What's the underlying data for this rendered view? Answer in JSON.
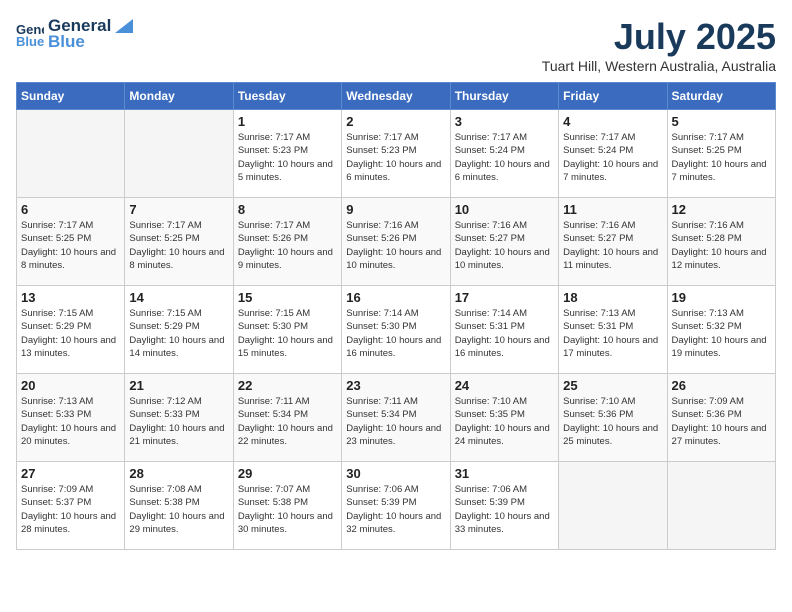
{
  "header": {
    "logo_line1": "General",
    "logo_line2": "Blue",
    "month": "July 2025",
    "location": "Tuart Hill, Western Australia, Australia"
  },
  "weekdays": [
    "Sunday",
    "Monday",
    "Tuesday",
    "Wednesday",
    "Thursday",
    "Friday",
    "Saturday"
  ],
  "weeks": [
    [
      {
        "day": "",
        "sunrise": "",
        "sunset": "",
        "daylight": ""
      },
      {
        "day": "",
        "sunrise": "",
        "sunset": "",
        "daylight": ""
      },
      {
        "day": "1",
        "sunrise": "Sunrise: 7:17 AM",
        "sunset": "Sunset: 5:23 PM",
        "daylight": "Daylight: 10 hours and 5 minutes."
      },
      {
        "day": "2",
        "sunrise": "Sunrise: 7:17 AM",
        "sunset": "Sunset: 5:23 PM",
        "daylight": "Daylight: 10 hours and 6 minutes."
      },
      {
        "day": "3",
        "sunrise": "Sunrise: 7:17 AM",
        "sunset": "Sunset: 5:24 PM",
        "daylight": "Daylight: 10 hours and 6 minutes."
      },
      {
        "day": "4",
        "sunrise": "Sunrise: 7:17 AM",
        "sunset": "Sunset: 5:24 PM",
        "daylight": "Daylight: 10 hours and 7 minutes."
      },
      {
        "day": "5",
        "sunrise": "Sunrise: 7:17 AM",
        "sunset": "Sunset: 5:25 PM",
        "daylight": "Daylight: 10 hours and 7 minutes."
      }
    ],
    [
      {
        "day": "6",
        "sunrise": "Sunrise: 7:17 AM",
        "sunset": "Sunset: 5:25 PM",
        "daylight": "Daylight: 10 hours and 8 minutes."
      },
      {
        "day": "7",
        "sunrise": "Sunrise: 7:17 AM",
        "sunset": "Sunset: 5:25 PM",
        "daylight": "Daylight: 10 hours and 8 minutes."
      },
      {
        "day": "8",
        "sunrise": "Sunrise: 7:17 AM",
        "sunset": "Sunset: 5:26 PM",
        "daylight": "Daylight: 10 hours and 9 minutes."
      },
      {
        "day": "9",
        "sunrise": "Sunrise: 7:16 AM",
        "sunset": "Sunset: 5:26 PM",
        "daylight": "Daylight: 10 hours and 10 minutes."
      },
      {
        "day": "10",
        "sunrise": "Sunrise: 7:16 AM",
        "sunset": "Sunset: 5:27 PM",
        "daylight": "Daylight: 10 hours and 10 minutes."
      },
      {
        "day": "11",
        "sunrise": "Sunrise: 7:16 AM",
        "sunset": "Sunset: 5:27 PM",
        "daylight": "Daylight: 10 hours and 11 minutes."
      },
      {
        "day": "12",
        "sunrise": "Sunrise: 7:16 AM",
        "sunset": "Sunset: 5:28 PM",
        "daylight": "Daylight: 10 hours and 12 minutes."
      }
    ],
    [
      {
        "day": "13",
        "sunrise": "Sunrise: 7:15 AM",
        "sunset": "Sunset: 5:29 PM",
        "daylight": "Daylight: 10 hours and 13 minutes."
      },
      {
        "day": "14",
        "sunrise": "Sunrise: 7:15 AM",
        "sunset": "Sunset: 5:29 PM",
        "daylight": "Daylight: 10 hours and 14 minutes."
      },
      {
        "day": "15",
        "sunrise": "Sunrise: 7:15 AM",
        "sunset": "Sunset: 5:30 PM",
        "daylight": "Daylight: 10 hours and 15 minutes."
      },
      {
        "day": "16",
        "sunrise": "Sunrise: 7:14 AM",
        "sunset": "Sunset: 5:30 PM",
        "daylight": "Daylight: 10 hours and 16 minutes."
      },
      {
        "day": "17",
        "sunrise": "Sunrise: 7:14 AM",
        "sunset": "Sunset: 5:31 PM",
        "daylight": "Daylight: 10 hours and 16 minutes."
      },
      {
        "day": "18",
        "sunrise": "Sunrise: 7:13 AM",
        "sunset": "Sunset: 5:31 PM",
        "daylight": "Daylight: 10 hours and 17 minutes."
      },
      {
        "day": "19",
        "sunrise": "Sunrise: 7:13 AM",
        "sunset": "Sunset: 5:32 PM",
        "daylight": "Daylight: 10 hours and 19 minutes."
      }
    ],
    [
      {
        "day": "20",
        "sunrise": "Sunrise: 7:13 AM",
        "sunset": "Sunset: 5:33 PM",
        "daylight": "Daylight: 10 hours and 20 minutes."
      },
      {
        "day": "21",
        "sunrise": "Sunrise: 7:12 AM",
        "sunset": "Sunset: 5:33 PM",
        "daylight": "Daylight: 10 hours and 21 minutes."
      },
      {
        "day": "22",
        "sunrise": "Sunrise: 7:11 AM",
        "sunset": "Sunset: 5:34 PM",
        "daylight": "Daylight: 10 hours and 22 minutes."
      },
      {
        "day": "23",
        "sunrise": "Sunrise: 7:11 AM",
        "sunset": "Sunset: 5:34 PM",
        "daylight": "Daylight: 10 hours and 23 minutes."
      },
      {
        "day": "24",
        "sunrise": "Sunrise: 7:10 AM",
        "sunset": "Sunset: 5:35 PM",
        "daylight": "Daylight: 10 hours and 24 minutes."
      },
      {
        "day": "25",
        "sunrise": "Sunrise: 7:10 AM",
        "sunset": "Sunset: 5:36 PM",
        "daylight": "Daylight: 10 hours and 25 minutes."
      },
      {
        "day": "26",
        "sunrise": "Sunrise: 7:09 AM",
        "sunset": "Sunset: 5:36 PM",
        "daylight": "Daylight: 10 hours and 27 minutes."
      }
    ],
    [
      {
        "day": "27",
        "sunrise": "Sunrise: 7:09 AM",
        "sunset": "Sunset: 5:37 PM",
        "daylight": "Daylight: 10 hours and 28 minutes."
      },
      {
        "day": "28",
        "sunrise": "Sunrise: 7:08 AM",
        "sunset": "Sunset: 5:38 PM",
        "daylight": "Daylight: 10 hours and 29 minutes."
      },
      {
        "day": "29",
        "sunrise": "Sunrise: 7:07 AM",
        "sunset": "Sunset: 5:38 PM",
        "daylight": "Daylight: 10 hours and 30 minutes."
      },
      {
        "day": "30",
        "sunrise": "Sunrise: 7:06 AM",
        "sunset": "Sunset: 5:39 PM",
        "daylight": "Daylight: 10 hours and 32 minutes."
      },
      {
        "day": "31",
        "sunrise": "Sunrise: 7:06 AM",
        "sunset": "Sunset: 5:39 PM",
        "daylight": "Daylight: 10 hours and 33 minutes."
      },
      {
        "day": "",
        "sunrise": "",
        "sunset": "",
        "daylight": ""
      },
      {
        "day": "",
        "sunrise": "",
        "sunset": "",
        "daylight": ""
      }
    ]
  ]
}
